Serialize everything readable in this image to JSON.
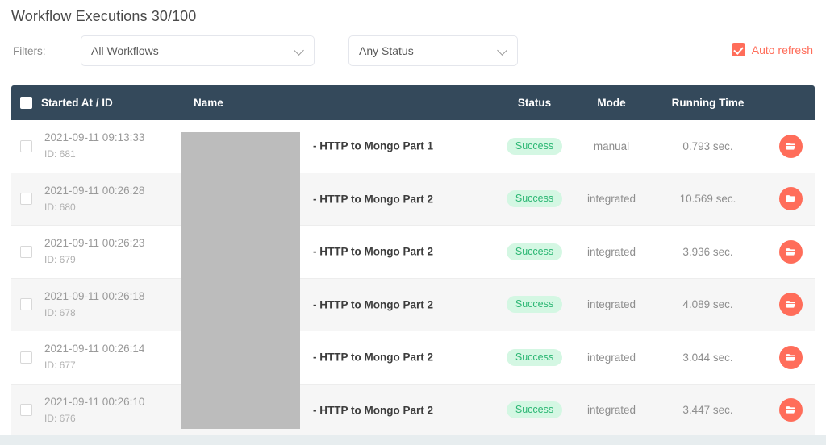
{
  "header": {
    "title": "Workflow Executions 30/100"
  },
  "filters": {
    "label": "Filters:",
    "workflow_select": {
      "value": "All Workflows",
      "icon": "chevron-down-icon"
    },
    "status_select": {
      "value": "Any Status",
      "icon": "chevron-down-icon"
    },
    "auto_refresh": {
      "label": "Auto refresh",
      "checked": true,
      "color": "#ff6d5a"
    }
  },
  "table": {
    "columns": {
      "started_at": "Started At / ID",
      "name": "Name",
      "status": "Status",
      "mode": "Mode",
      "running_time": "Running Time"
    },
    "header_bg": "#34495b",
    "id_prefix": "ID: ",
    "rows": [
      {
        "started_at": "2021-09-11 09:13:33",
        "id": "ID: 681",
        "name": "- HTTP to Mongo Part 1",
        "status": "Success",
        "mode": "manual",
        "running_time": "0.793 sec.",
        "action_icon": "folder-icon"
      },
      {
        "started_at": "2021-09-11 00:26:28",
        "id": "ID: 680",
        "name": "- HTTP to Mongo Part 2",
        "status": "Success",
        "mode": "integrated",
        "running_time": "10.569 sec.",
        "action_icon": "folder-icon"
      },
      {
        "started_at": "2021-09-11 00:26:23",
        "id": "ID: 679",
        "name": "- HTTP to Mongo Part 2",
        "status": "Success",
        "mode": "integrated",
        "running_time": "3.936 sec.",
        "action_icon": "folder-icon"
      },
      {
        "started_at": "2021-09-11 00:26:18",
        "id": "ID: 678",
        "name": "- HTTP to Mongo Part 2",
        "status": "Success",
        "mode": "integrated",
        "running_time": "4.089 sec.",
        "action_icon": "folder-icon"
      },
      {
        "started_at": "2021-09-11 00:26:14",
        "id": "ID: 677",
        "name": "- HTTP to Mongo Part 2",
        "status": "Success",
        "mode": "integrated",
        "running_time": "3.044 sec.",
        "action_icon": "folder-icon"
      },
      {
        "started_at": "2021-09-11 00:26:10",
        "id": "ID: 676",
        "name": "- HTTP to Mongo Part 2",
        "status": "Success",
        "mode": "integrated",
        "running_time": "3.447 sec.",
        "action_icon": "folder-icon"
      }
    ]
  },
  "colors": {
    "accent": "#ff6d5a",
    "header_bg": "#34495b",
    "status_success_bg": "#d4f7e3",
    "status_success_text": "#2bb673",
    "redaction": "#bcbcbc"
  }
}
